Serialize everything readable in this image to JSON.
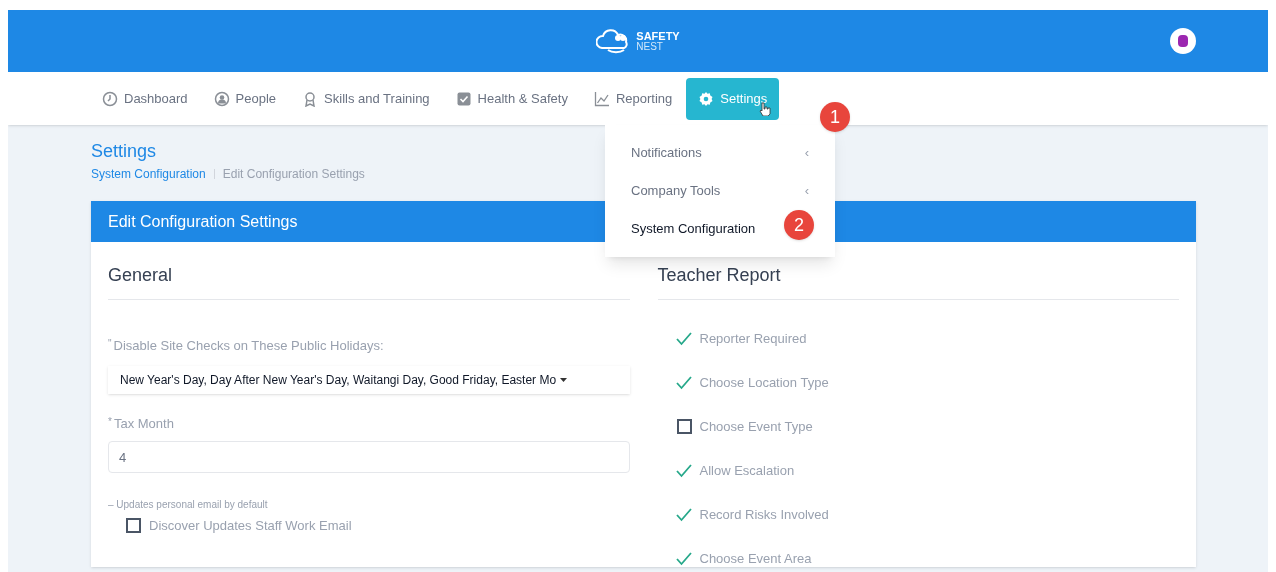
{
  "header": {
    "logo_line_1": "SAFETY",
    "logo_line_2": "NEST"
  },
  "nav": [
    {
      "label": "Dashboard",
      "kind": "clock",
      "selected": false
    },
    {
      "label": "People",
      "kind": "person",
      "selected": false
    },
    {
      "label": "Skills and Training",
      "kind": "award",
      "selected": false
    },
    {
      "label": "Health & Safety",
      "kind": "check",
      "selected": false
    },
    {
      "label": "Reporting",
      "kind": "chart",
      "selected": false
    },
    {
      "label": "Settings",
      "kind": "gear",
      "selected": true
    }
  ],
  "dropdown": {
    "items": [
      {
        "label": "Notifications",
        "submenu_glyph": "‹",
        "selected": false
      },
      {
        "label": "Company Tools",
        "submenu_glyph": "‹",
        "selected": false
      },
      {
        "label": "System Configuration",
        "selected": true
      }
    ]
  },
  "step_badges": [
    "1",
    "2"
  ],
  "page": {
    "title": "Settings",
    "breadcrumb": [
      "System Configuration",
      "Edit Configuration Settings"
    ]
  },
  "card": {
    "title": "Edit Configuration Settings",
    "general": {
      "title": "General",
      "holidays": {
        "required_mark": "\"",
        "label": "Disable Site Checks on These Public Holidays:",
        "value": "New Year's Day, Day After New Year's Day, Waitangi Day, Good Friday, Easter Mo"
      },
      "tax_month": {
        "required_mark": "*",
        "label": "Tax Month",
        "value": "4"
      },
      "note": "– Updates personal email by default",
      "checkbox": {
        "label": "Discover Updates Staff Work Email",
        "checked": false
      }
    },
    "teacher_report": {
      "title": "Teacher Report",
      "items": [
        {
          "label": "Reporter Required",
          "checked": true
        },
        {
          "label": "Choose Location Type",
          "checked": true
        },
        {
          "label": "Choose Event Type",
          "checked": false
        },
        {
          "label": "Allow Escalation",
          "checked": true
        },
        {
          "label": "Record Risks Involved",
          "checked": true
        },
        {
          "label": "Choose Event Area",
          "checked": true
        }
      ]
    }
  }
}
